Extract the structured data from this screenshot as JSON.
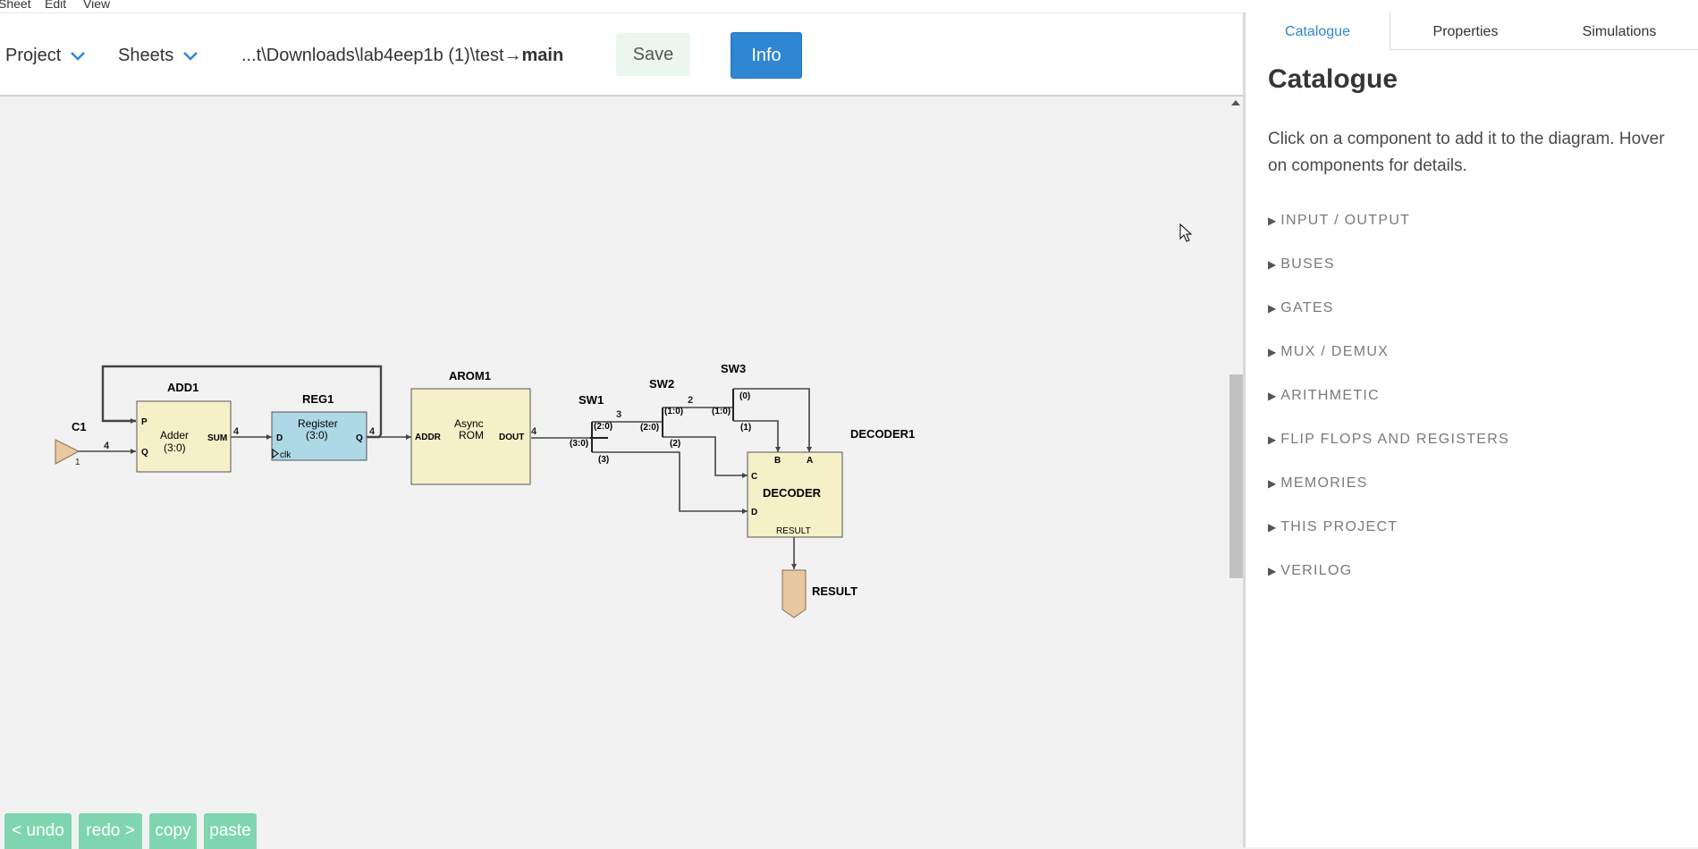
{
  "menu": {
    "items": [
      "Sheet",
      "Edit",
      "View"
    ]
  },
  "toolbar": {
    "project_label": "Project",
    "sheets_label": "Sheets",
    "path_prefix": "...t\\Downloads\\lab4eep1b (1)\\test→",
    "path_sheet": "main",
    "save_label": "Save",
    "info_label": "Info"
  },
  "diagram": {
    "c1_label": "C1",
    "c1_value": "1",
    "add1_label": "ADD1",
    "add1_line1": "Adder",
    "add1_line2": "(3:0)",
    "add1_p": "P",
    "add1_q": "Q",
    "add1_sum": "SUM",
    "reg1_label": "REG1",
    "reg1_line1": "Register",
    "reg1_line2": "(3:0)",
    "reg1_d": "D",
    "reg1_q": "Q",
    "reg1_clk": "clk",
    "arom1_label": "AROM1",
    "arom1_line1": "Async",
    "arom1_line2": "ROM",
    "arom1_addr": "ADDR",
    "arom1_dout": "DOUT",
    "sw1_label": "SW1",
    "sw1_in": "(3:0)",
    "sw1_out_top": "(2:0)",
    "sw1_out_bottom": "(3)",
    "sw2_label": "SW2",
    "sw2_in": "(2:0)",
    "sw2_out_top": "(1:0)",
    "sw2_out_bottom": "(2)",
    "sw3_label": "SW3",
    "sw3_in": "(1:0)",
    "sw3_out_top": "(0)",
    "sw3_out_bottom": "(1)",
    "decoder1_label": "DECODER1",
    "decoder_title": "DECODER",
    "dec_b": "B",
    "dec_a": "A",
    "dec_c": "C",
    "dec_d": "D",
    "dec_result": "RESULT",
    "result_label": "RESULT",
    "w_c1": "4",
    "w_sum": "4",
    "w_reg": "4",
    "w_dout": "4",
    "w_sw1": "3",
    "w_sw2": "2"
  },
  "right_panel": {
    "tabs": [
      "Catalogue",
      "Properties",
      "Simulations"
    ],
    "active_tab": "Catalogue",
    "title": "Catalogue",
    "description": "Click on a component to add it to the diagram. Hover on components for details.",
    "categories": [
      "INPUT / OUTPUT",
      "BUSES",
      "GATES",
      "MUX / DEMUX",
      "ARITHMETIC",
      "FLIP FLOPS AND REGISTERS",
      "MEMORIES",
      "THIS PROJECT",
      "VERILOG"
    ]
  },
  "bottom_buttons": {
    "undo": "< undo",
    "redo": "redo >",
    "copy": "copy",
    "paste": "paste"
  },
  "colors": {
    "accent": "#2f86d2",
    "component_fill": "#f5f0c8",
    "register_fill": "#add8e6",
    "io_fill": "#e8c8a0",
    "undo_bar": "#7fd6ae"
  }
}
